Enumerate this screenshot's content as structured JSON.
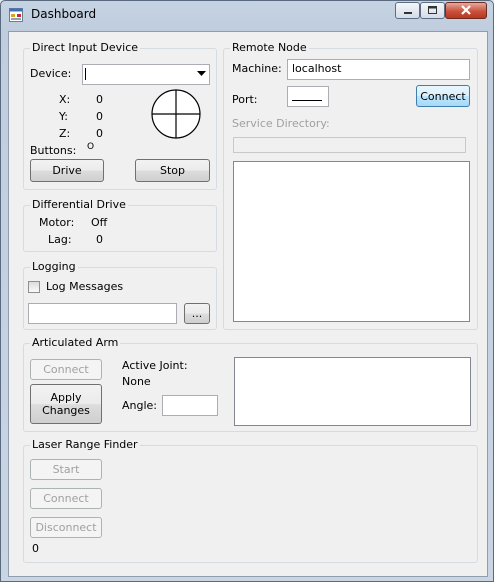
{
  "window": {
    "title": "Dashboard"
  },
  "direct_input": {
    "title": "Direct Input Device",
    "device_label": "Device:",
    "device_value": "",
    "x_label": "X:",
    "x_value": "0",
    "y_label": "Y:",
    "y_value": "0",
    "z_label": "Z:",
    "z_value": "0",
    "buttons_label": "Buttons:",
    "buttons_value": "O",
    "drive_label": "Drive",
    "stop_label": "Stop"
  },
  "differential_drive": {
    "title": "Differential Drive",
    "motor_label": "Motor:",
    "motor_value": "Off",
    "lag_label": "Lag:",
    "lag_value": "0"
  },
  "logging": {
    "title": "Logging",
    "log_messages_label": "Log Messages",
    "log_messages_checked": false,
    "file_value": "",
    "browse_label": "..."
  },
  "remote_node": {
    "title": "Remote Node",
    "machine_label": "Machine:",
    "machine_value": "localhost",
    "port_label": "Port:",
    "port_value": "",
    "connect_label": "Connect",
    "service_directory_label": "Service Directory:",
    "service_directory_value": ""
  },
  "articulated_arm": {
    "title": "Articulated Arm",
    "connect_label": "Connect",
    "apply_label": "Apply Changes",
    "active_joint_label": "Active Joint:",
    "active_joint_value": "None",
    "angle_label": "Angle:",
    "angle_value": ""
  },
  "laser": {
    "title": "Laser Range Finder",
    "start_label": "Start",
    "connect_label": "Connect",
    "disconnect_label": "Disconnect",
    "value": "0"
  }
}
